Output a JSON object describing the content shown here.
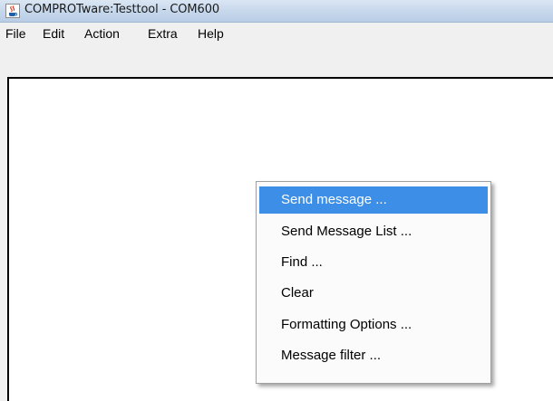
{
  "window": {
    "title": "COMPROTware:Testtool - COM600"
  },
  "menubar": {
    "items": [
      {
        "label": "File"
      },
      {
        "label": "Edit"
      },
      {
        "label": "Action"
      },
      {
        "label": "Extra"
      },
      {
        "label": "Help"
      }
    ]
  },
  "context_menu": {
    "items": [
      {
        "label": "Send message ...",
        "highlighted": true
      },
      {
        "label": "Send Message List ...",
        "highlighted": false
      },
      {
        "label": "Find ...",
        "highlighted": false
      },
      {
        "label": "Clear",
        "highlighted": false
      },
      {
        "label": "Formatting Options ...",
        "highlighted": false
      },
      {
        "label": "Message filter ...",
        "highlighted": false
      }
    ]
  },
  "colors": {
    "highlight": "#3d8ee6",
    "titlebar": "#c7d8ec"
  },
  "icons": {
    "app_icon": "java-coffee-cup-icon"
  }
}
